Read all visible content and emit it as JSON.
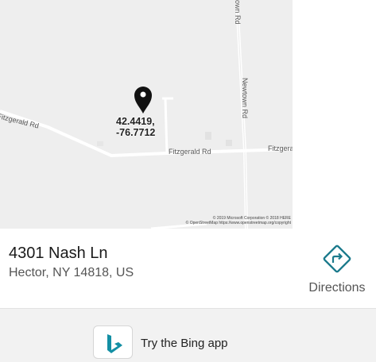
{
  "map": {
    "roads": {
      "newtown_top": "own Rd",
      "newtown": "Newtown Rd",
      "fitzgerald_left": "Fitzgerald Rd",
      "fitzgerald_mid": "Fitzgerald Rd",
      "fitzgerald_right": "Fitzgera"
    },
    "coordinates": {
      "lat": "42.4419,",
      "lon": "-76.7712"
    },
    "attribution": {
      "line1": "© 2019 Microsoft Corporation © 2018 HERE",
      "line2": "© OpenStreetMap https://www.openstreetmap.org/copyright"
    },
    "pin_icon": "map-pin-icon"
  },
  "location": {
    "title": "4301 Nash Ln",
    "subtitle": "Hector, NY 14818, US"
  },
  "actions": {
    "directions_label": "Directions",
    "directions_icon": "directions-icon",
    "directions_color": "#1b7a8c"
  },
  "promo": {
    "text": "Try the Bing app",
    "icon": "bing-logo-icon",
    "icon_color": "#138fa4"
  }
}
